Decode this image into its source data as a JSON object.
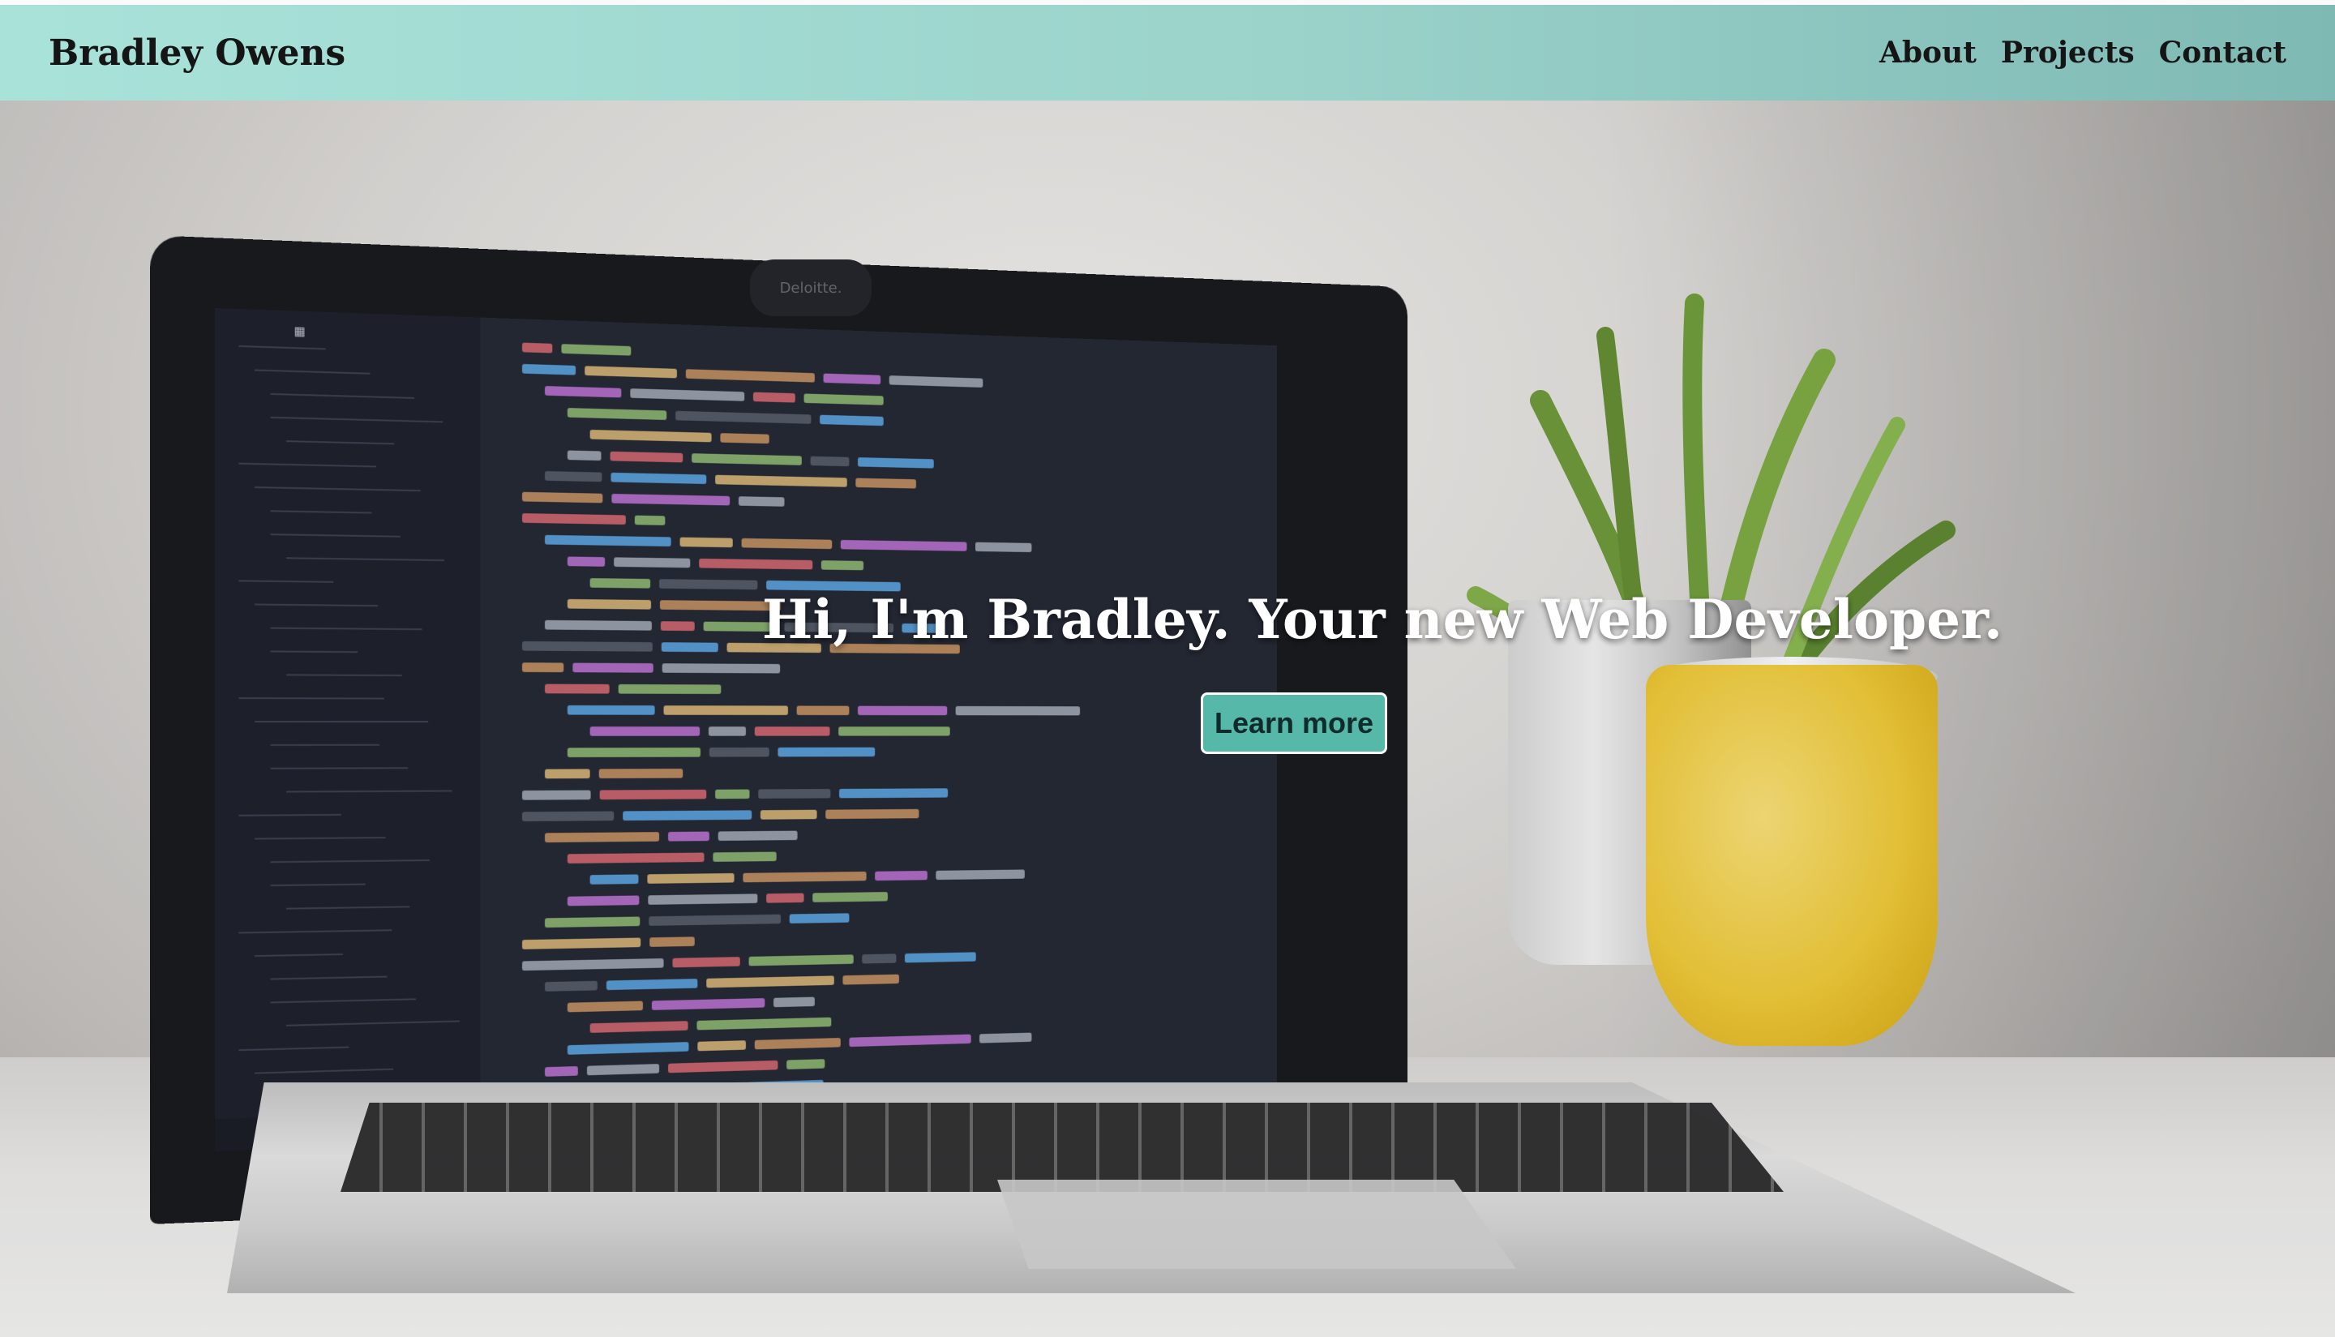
{
  "navbar": {
    "brand": "Bradley Owens",
    "links": [
      {
        "label": "About"
      },
      {
        "label": "Projects"
      },
      {
        "label": "Contact"
      }
    ]
  },
  "hero": {
    "headline": "Hi, I'm Bradley. Your new Web Developer.",
    "cta_label": "Learn more",
    "image_camera_label": "Deloitte."
  },
  "colors": {
    "navbar_start": "#a8e2d9",
    "navbar_end": "#7fb9b4",
    "cta_background": "#56b8a9",
    "headline_text": "#ffffff"
  },
  "code_palette": [
    "#e06c75",
    "#61afef",
    "#c678dd",
    "#98c379",
    "#e5c07b",
    "#abb2bf",
    "#5c6370",
    "#d19a66"
  ]
}
